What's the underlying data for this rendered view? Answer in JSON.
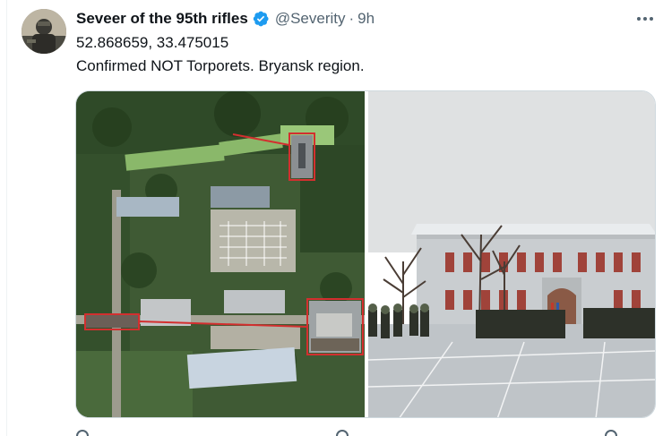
{
  "tweet": {
    "display_name": "Seveer of the 95th rifles",
    "handle": "@Severity",
    "separator": "·",
    "time": "9h",
    "text_lines": [
      "52.868659, 33.475015",
      "Confirmed NOT Torporets. Bryansk region."
    ]
  },
  "icons": {
    "avatar": "avatar-image",
    "verified": "verified-badge-icon",
    "more": "more-options-icon"
  },
  "media": {
    "left_image": "satellite-photo",
    "right_image": "barracks-photo"
  },
  "colors": {
    "verified_blue": "#1d9bf0",
    "secondary_text": "#536471",
    "primary_text": "#0f1419",
    "annotation_red": "#d32f2f"
  }
}
